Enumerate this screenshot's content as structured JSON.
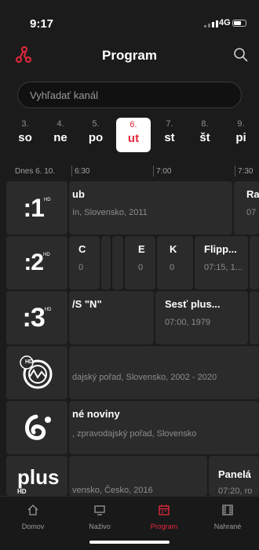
{
  "status": {
    "time": "9:17",
    "network": "4G"
  },
  "header": {
    "title": "Program",
    "logo_icon": "share-nodes-icon",
    "search_icon": "search-icon"
  },
  "search": {
    "placeholder": "Vyhľadať kanál"
  },
  "days": [
    {
      "num": "3.",
      "name": "so"
    },
    {
      "num": "4.",
      "name": "ne"
    },
    {
      "num": "5.",
      "name": "po"
    },
    {
      "num": "6.",
      "name": "ut",
      "selected": true
    },
    {
      "num": "7.",
      "name": "st"
    },
    {
      "num": "8.",
      "name": "št"
    },
    {
      "num": "9.",
      "name": "pi"
    }
  ],
  "timeline": {
    "date": "Dnes 6. 10.",
    "t1": "6:30",
    "t2": "7:00",
    "t3": "7:30"
  },
  "channels": [
    {
      "logo": ":1",
      "programs": [
        {
          "title": "ub",
          "sub": "ín, Slovensko, 2011"
        },
        {
          "title": "Ra",
          "sub": "07"
        }
      ]
    },
    {
      "logo": ":2",
      "programs": [
        {
          "title": "C",
          "sub": "0"
        },
        {
          "title": "",
          "sub": ""
        },
        {
          "title": "E",
          "sub": "0"
        },
        {
          "title": "K",
          "sub": "0"
        },
        {
          "title": "Flipp...",
          "sub": "07:15, 1..."
        },
        {
          "title": "",
          "sub": ""
        }
      ]
    },
    {
      "logo": ":3",
      "programs": [
        {
          "title": "/S \"N\"",
          "sub": ""
        },
        {
          "title": "Sesť plus...",
          "sub": "07:00, 1979"
        },
        {
          "title": "",
          "sub": ""
        }
      ]
    },
    {
      "logo": "HD",
      "programs": [
        {
          "title": "",
          "sub": "dajský pořad, Slovensko, 2002 - 2020"
        }
      ]
    },
    {
      "logo": "C",
      "programs": [
        {
          "title": "né noviny",
          "sub": ", zpravodajský pořad, Slovensko"
        }
      ]
    },
    {
      "logo": "plus",
      "logo_sub": "HD",
      "programs": [
        {
          "title": "",
          "sub": "vensko, Česko, 2016"
        },
        {
          "title": "Panelá",
          "sub": "07:20, ro"
        }
      ]
    }
  ],
  "tabs": [
    {
      "label": "Domov",
      "icon": "home-icon"
    },
    {
      "label": "Naživo",
      "icon": "monitor-icon"
    },
    {
      "label": "Program",
      "icon": "calendar-icon",
      "active": true
    },
    {
      "label": "Nahrané",
      "icon": "film-icon"
    }
  ],
  "colors": {
    "accent": "#e4283c",
    "background": "#1b1b1b",
    "tile": "#2b2b2b"
  }
}
